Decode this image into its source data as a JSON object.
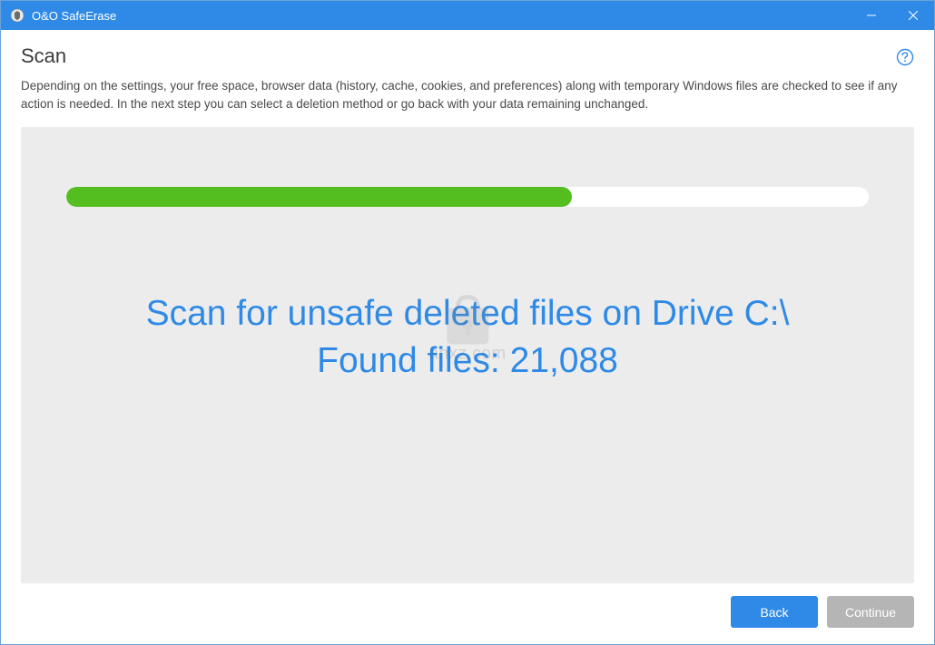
{
  "window": {
    "title": "O&O SafeErase"
  },
  "page": {
    "title": "Scan",
    "description": "Depending on the settings, your free space, browser data (history, cache, cookies, and preferences) along with temporary Windows files are checked to see if any action is needed. In the next step you can select a deletion method or go back with your data remaining unchanged."
  },
  "progress": {
    "percent": 63
  },
  "status": {
    "line1": "Scan for unsafe deleted files on Drive C:\\",
    "line2": "Found files: 21,088"
  },
  "watermark": {
    "text": "anxz.com"
  },
  "footer": {
    "back": "Back",
    "continue": "Continue"
  }
}
